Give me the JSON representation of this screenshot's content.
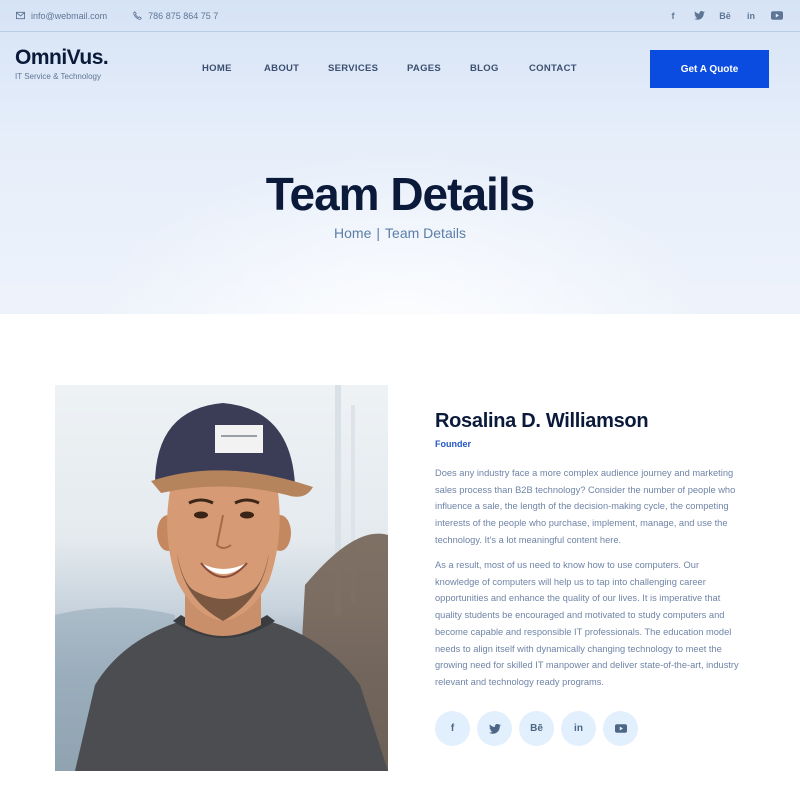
{
  "topbar": {
    "email": "info@webmail.com",
    "phone": "786 875 864 75 7",
    "socials": [
      {
        "icon": "facebook-icon",
        "glyph": "f"
      },
      {
        "icon": "twitter-icon",
        "glyph": ""
      },
      {
        "icon": "behance-icon",
        "glyph": "Bē"
      },
      {
        "icon": "linkedin-icon",
        "glyph": "in"
      },
      {
        "icon": "youtube-icon",
        "glyph": ""
      }
    ]
  },
  "header": {
    "logo_name": "OmniVus.",
    "logo_tagline": "IT Service & Technology",
    "nav": [
      "HOME",
      "ABOUT",
      "SERVICES",
      "PAGES",
      "BLOG",
      "CONTACT"
    ],
    "cta_label": "Get A Quote"
  },
  "hero": {
    "title": "Team Details",
    "breadcrumb_home": "Home",
    "breadcrumb_sep": "|",
    "breadcrumb_current": "Team Details"
  },
  "profile": {
    "name": "Rosalina D. Williamson",
    "role": "Founder",
    "paragraph_1": "Does any industry face a more complex audience journey and marketing sales process than B2B technology? Consider the number of people who influence a sale, the length of the decision-making cycle, the competing interests of the people who purchase, implement, manage, and use the technology. It's a lot meaningful content here.",
    "paragraph_2": "As a result, most of us need to know how to use computers. Our knowledge of computers will help us to tap into challenging career opportunities and enhance the quality of our lives. It is imperative that quality students be encouraged and motivated to study computers and become capable and responsible IT professionals. The education model needs to align itself with dynamically changing technology to meet the growing need for skilled IT manpower and deliver state-of-the-art, industry relevant and technology ready programs.",
    "socials": [
      "f",
      "",
      "Bē",
      "in",
      ""
    ]
  },
  "colors": {
    "accent": "#0a4be0",
    "heading": "#0b1a3a",
    "body_text": "#6f84a6",
    "social_bg": "#e2effc"
  }
}
